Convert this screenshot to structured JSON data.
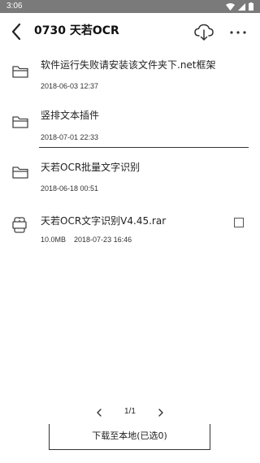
{
  "status_bar": {
    "time": "3:06",
    "icons": [
      "wifi-icon",
      "signal-icon",
      "battery-icon"
    ]
  },
  "header": {
    "title": "0730 天若OCR",
    "back_icon": "arrow-left-icon",
    "download_icon": "cloud-download-icon",
    "more_icon": "more-horizontal-icon"
  },
  "files": [
    {
      "type": "folder",
      "icon": "folder-icon",
      "name": "软件运行失败请安装该文件夹下.net框架",
      "size": "",
      "date": "2018-06-03 12:37"
    },
    {
      "type": "folder",
      "icon": "folder-icon",
      "name": "竖排文本插件",
      "size": "",
      "date": "2018-07-01 22:33"
    },
    {
      "type": "folder",
      "icon": "folder-icon",
      "name": "天若OCR批量文字识别",
      "size": "",
      "date": "2018-06-18 00:51"
    },
    {
      "type": "archive",
      "icon": "archive-file-icon",
      "name": "天若OCR文字识别V4.45.rar",
      "size": "10.0MB",
      "date": "2018-07-23 16:46",
      "checked": false
    }
  ],
  "pagination": {
    "indicator": "1/1",
    "prev_icon": "chevron-left-icon",
    "next_icon": "chevron-right-icon"
  },
  "actions": {
    "download_local_label": "下载至本地(已选0)"
  },
  "colors": {
    "status_bar_bg": "#7a7a7a",
    "background": "#ffffff",
    "text": "#222222"
  }
}
